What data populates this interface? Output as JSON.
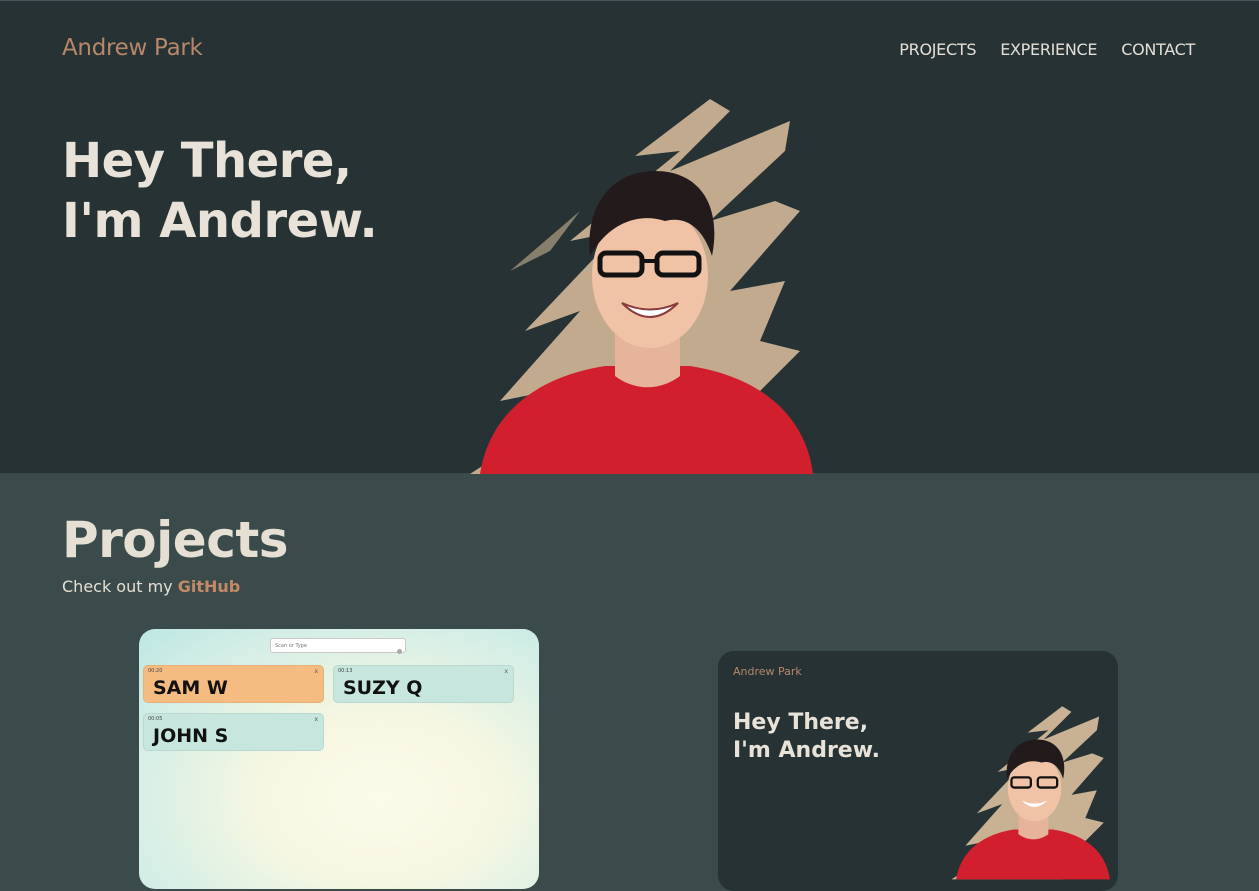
{
  "header": {
    "brand": "Andrew Park",
    "nav": [
      "PROJECTS",
      "EXPERIENCE",
      "CONTACT"
    ]
  },
  "hero": {
    "title_line1": "Hey There,",
    "title_line2": "I'm Andrew."
  },
  "projects": {
    "title": "Projects",
    "subtitle_prefix": "Check out my ",
    "github_link": "GitHub",
    "cards": [
      {
        "search_placeholder": "Scan or Type",
        "tiles": [
          {
            "time": "00:20",
            "name": "SAM W",
            "close": "x"
          },
          {
            "time": "00:13",
            "name": "SUZY Q",
            "close": "x"
          },
          {
            "time": "00:05",
            "name": "JOHN S",
            "close": "x"
          }
        ]
      },
      {
        "brand": "Andrew Park",
        "title_line1": "Hey There,",
        "title_line2": "I'm Andrew."
      }
    ]
  },
  "colors": {
    "hero_bg": "#263234",
    "section_bg": "#3b4b4b",
    "accent": "#b8866a",
    "text_light": "#e8e2d8",
    "shirt_red": "#d11f2e",
    "brush_tan": "#c9b193"
  }
}
